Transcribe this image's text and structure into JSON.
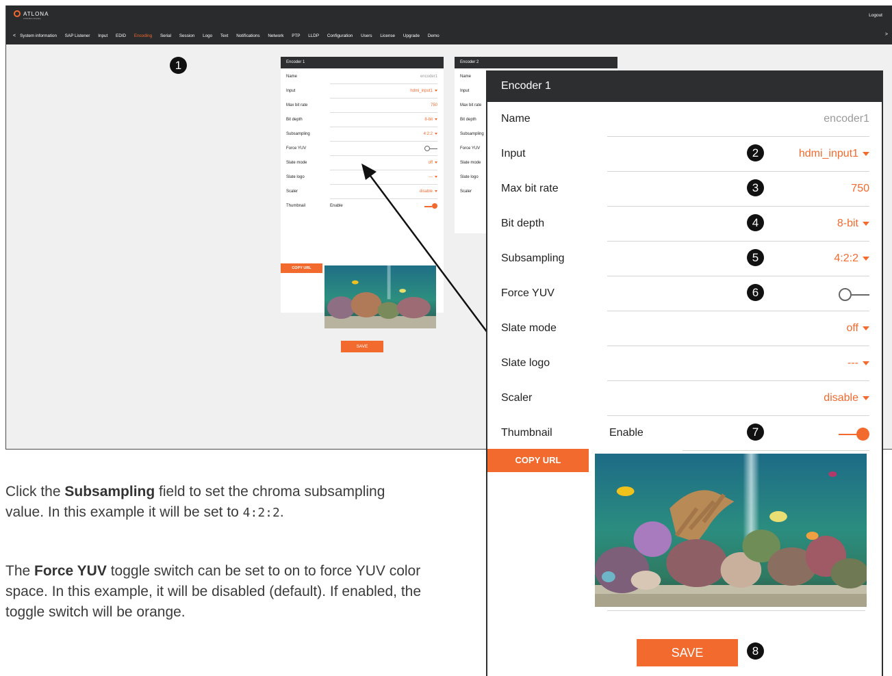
{
  "app": {
    "brand": "ATLONA",
    "brand_sub": "a Panduit company",
    "logout_label": "Logout"
  },
  "nav": {
    "left_arrow": "<",
    "right_arrow": ">",
    "items": [
      "System information",
      "SAP Listener",
      "Input",
      "EDID",
      "Encoding",
      "Serial",
      "Session",
      "Logo",
      "Text",
      "Notifications",
      "Network",
      "PTP",
      "LLDP",
      "Configuration",
      "Users",
      "License",
      "Upgrade",
      "Demo"
    ],
    "active": "Encoding"
  },
  "encoder1": {
    "title": "Encoder 1",
    "fields": [
      {
        "label": "Name",
        "value": "encoder1"
      },
      {
        "label": "Input",
        "value": "hdmi_input1"
      },
      {
        "label": "Max bit rate",
        "value": "750"
      },
      {
        "label": "Bit depth",
        "value": "8-bit"
      },
      {
        "label": "Subsampling",
        "value": "4:2:2"
      },
      {
        "label": "Force YUV",
        "value": "off"
      },
      {
        "label": "Slate mode",
        "value": "off"
      },
      {
        "label": "Slate logo",
        "value": "---"
      },
      {
        "label": "Scaler",
        "value": "disable"
      },
      {
        "label": "Thumbnail",
        "value": "on"
      }
    ],
    "thumbnail_enable_label": "Enable",
    "copy_url_label": "COPY URL",
    "save_label": "SAVE"
  },
  "encoder2": {
    "title": "Encoder 2",
    "labels": [
      "Name",
      "Input",
      "Max bit rate",
      "Bit depth",
      "Subsampling",
      "Force YUV",
      "Slate mode",
      "Slate logo",
      "Scaler"
    ]
  },
  "callouts": [
    "1",
    "2",
    "3",
    "4",
    "5",
    "6",
    "7",
    "8"
  ],
  "body_text": {
    "p1_before": "Click the ",
    "p1_bold": "Subsampling",
    "p1_after": " field to set the chroma subsampling value.  In this example it will be set to ",
    "p1_code": "4:2:2",
    "p1_end": ".",
    "p2_before": "The ",
    "p2_bold": "Force YUV",
    "p2_after": " toggle switch can be set to on to force YUV color space.  In this example, it will be disabled (default).  If enabled, the toggle switch will be orange."
  },
  "colors": {
    "accent": "#f26a2e",
    "header": "#2d2e30",
    "page_bg": "#f0f0f1"
  }
}
